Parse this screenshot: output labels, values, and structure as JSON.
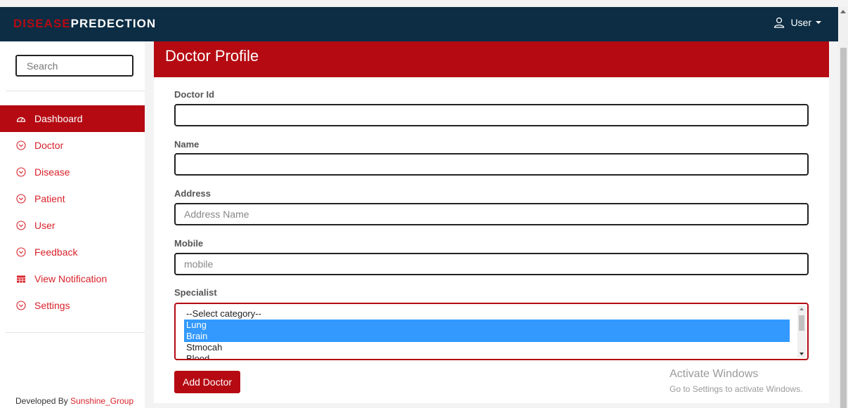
{
  "header": {
    "brand_part1": "DISEASE",
    "brand_part2": "PREDECTION",
    "user_label": "User"
  },
  "sidebar": {
    "search_placeholder": "Search",
    "items": [
      {
        "label": "Dashboard",
        "icon": "dashboard-icon",
        "active": true
      },
      {
        "label": "Doctor",
        "icon": "chevron-circle-icon"
      },
      {
        "label": "Disease",
        "icon": "chevron-circle-icon"
      },
      {
        "label": "Patient",
        "icon": "chevron-circle-icon"
      },
      {
        "label": "User",
        "icon": "chevron-circle-icon"
      },
      {
        "label": "Feedback",
        "icon": "chevron-circle-icon"
      },
      {
        "label": "View Notification",
        "icon": "table-icon"
      },
      {
        "label": "Settings",
        "icon": "chevron-circle-icon"
      }
    ],
    "footer_prefix": "Developed By",
    "footer_link": "Sunshine_Group"
  },
  "panel": {
    "title": "Doctor Profile",
    "fields": {
      "doctor_id": {
        "label": "Doctor Id",
        "value": "",
        "placeholder": ""
      },
      "name": {
        "label": "Name",
        "value": "",
        "placeholder": ""
      },
      "address": {
        "label": "Address",
        "placeholder": "Address Name"
      },
      "mobile": {
        "label": "Mobile",
        "placeholder": "mobile"
      }
    },
    "specialist": {
      "label": "Specialist",
      "options": [
        "--Select category--",
        "Lung",
        "Brain",
        "Stmocah",
        "Blood"
      ],
      "selected": [
        "Lung",
        "Brain"
      ]
    },
    "submit_label": "Add Doctor"
  },
  "watermark": {
    "line1": "Activate Windows",
    "line2": "Go to Settings to activate Windows."
  },
  "colors": {
    "navbar": "#0c2d44",
    "accent": "#b50a12",
    "selection": "#3399ff"
  }
}
